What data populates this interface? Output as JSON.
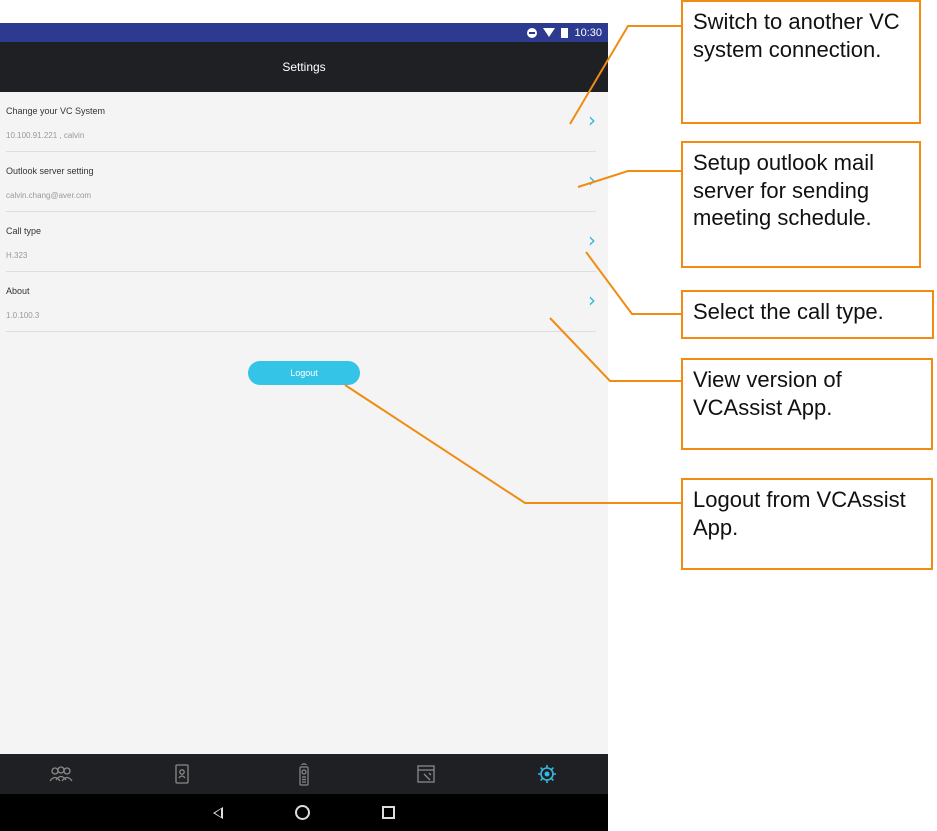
{
  "status_bar": {
    "time": "10:30"
  },
  "app_bar": {
    "title": "Settings"
  },
  "settings_items": [
    {
      "title": "Change your VC System",
      "value": "10.100.91.221 , calvin"
    },
    {
      "title": "Outlook server setting",
      "value": "calvin.chang@aver.com"
    },
    {
      "title": "Call type",
      "value": "H.323"
    },
    {
      "title": "About",
      "value": "1.0.100.3"
    }
  ],
  "logout_label": "Logout",
  "bottom_tabs": [
    "people-icon",
    "contacts-icon",
    "remote-icon",
    "window-settings-icon",
    "gear-icon"
  ],
  "callouts": [
    {
      "text": "Switch to another VC system connection."
    },
    {
      "text": "Setup outlook mail server for sending meeting schedule."
    },
    {
      "text": "Select the call type."
    },
    {
      "text": "View version of VCAssist App."
    },
    {
      "text": "Logout from VCAssist App."
    }
  ],
  "colors": {
    "accent": "#34c4e8",
    "callout_border": "#f08c14",
    "status_bar": "#2c3b8f",
    "app_bar": "#1f2023"
  }
}
